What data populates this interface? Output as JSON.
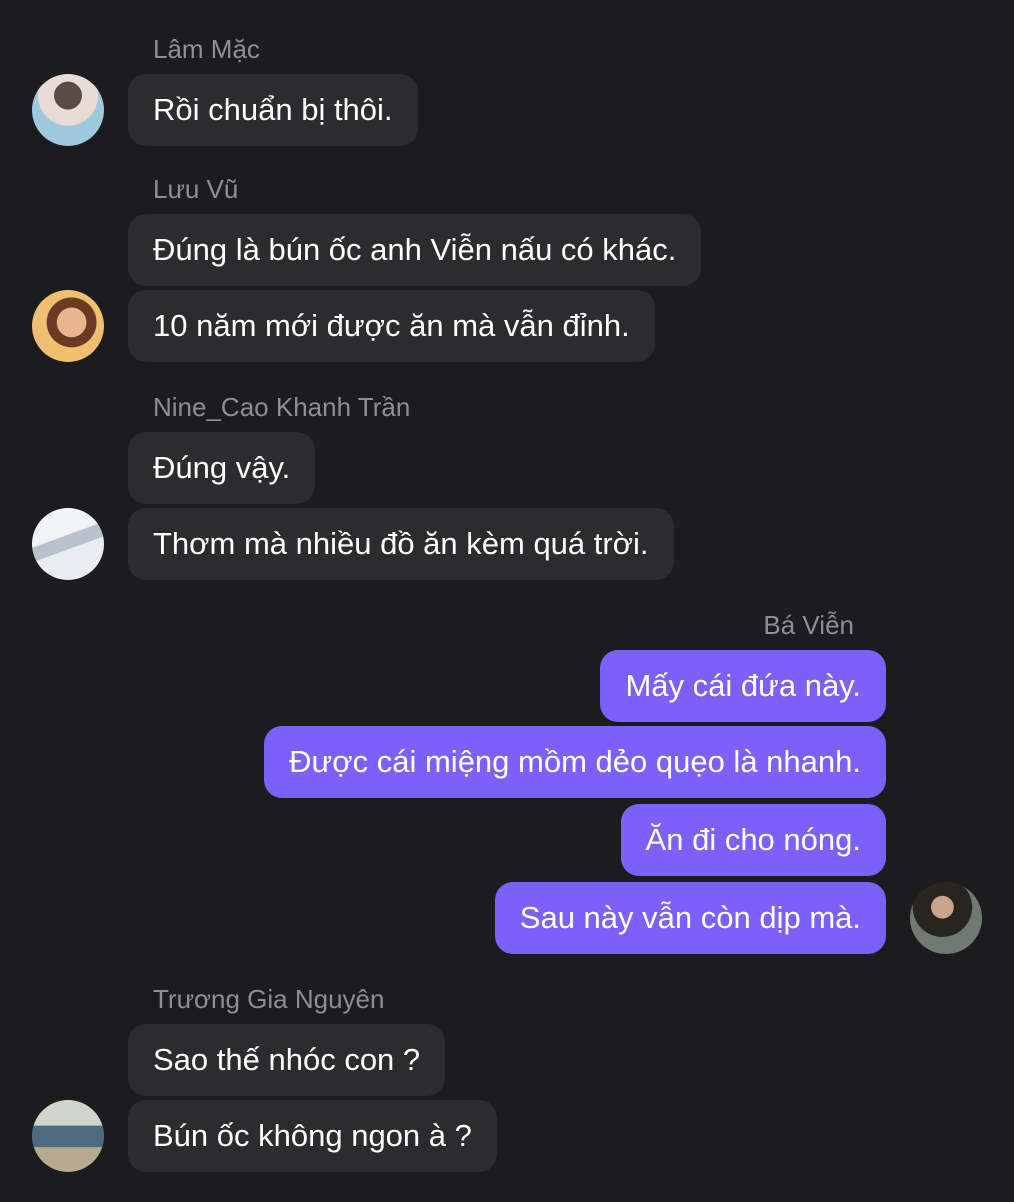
{
  "messages": {
    "group1": {
      "sender": "Lâm Mặc",
      "avatar_icon": "user-avatar-photo",
      "bubbles": [
        "Rồi chuẩn bị thôi."
      ]
    },
    "group2": {
      "sender": "Lưu Vũ",
      "avatar_icon": "user-avatar-photo",
      "bubbles": [
        "Đúng là bún ốc anh Viễn nấu có khác.",
        "10 năm mới được ăn mà vẫn đỉnh."
      ]
    },
    "group3": {
      "sender": "Nine_Cao Khanh Trần",
      "avatar_icon": "user-avatar-photo",
      "bubbles": [
        "Đúng vậy.",
        "Thơm mà nhiều đồ ăn kèm quá trời."
      ]
    },
    "group4": {
      "sender": "Bá Viễn",
      "avatar_icon": "user-avatar-photo",
      "bubbles": [
        "Mấy cái đứa này.",
        "Được cái miệng mồm dẻo quẹo là nhanh.",
        "Ăn đi cho nóng.",
        "Sau này vẫn còn dịp mà."
      ]
    },
    "group5": {
      "sender": "Trương Gia Nguyên",
      "avatar_icon": "user-avatar-photo",
      "bubbles": [
        "Sao thế nhóc con ?",
        "Bún ốc không ngon à ?"
      ]
    }
  },
  "colors": {
    "background": "#1c1c1e",
    "incoming_bubble": "#2c2c2e",
    "outgoing_bubble": "#7b61f8",
    "sender_name": "#8e8e93"
  }
}
